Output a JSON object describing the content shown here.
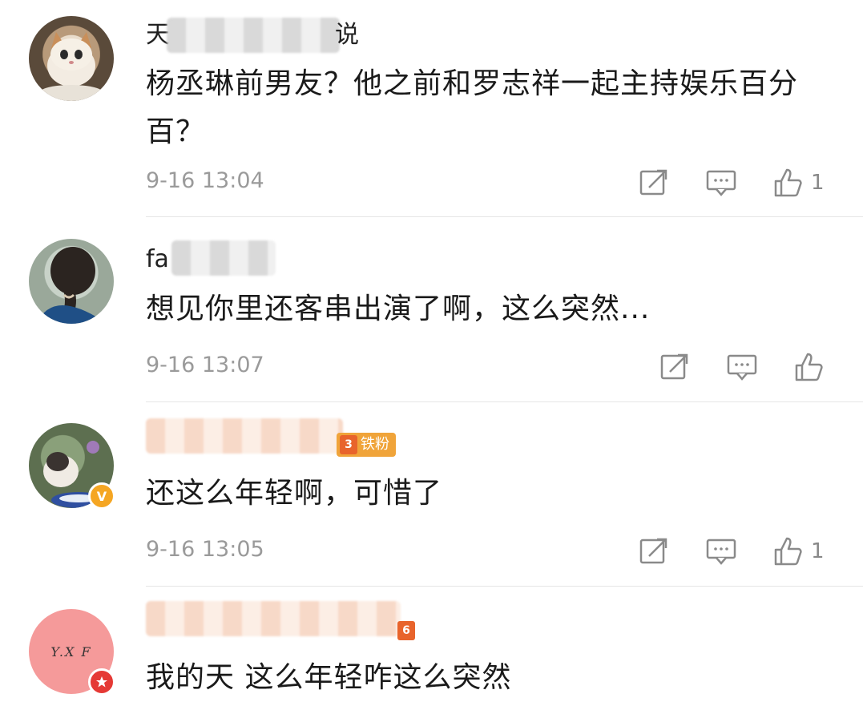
{
  "comments": [
    {
      "username": "天",
      "username_end": "说",
      "text": "杨丞琳前男友？他之前和罗志祥一起主持娱乐百分百？",
      "time": "9-16 13:04",
      "likes": "1",
      "avatar_desc": "cat-avatar"
    },
    {
      "username": "fa",
      "username_end": "",
      "text": "想见你里还客串出演了啊，这么突然...",
      "time": "9-16 13:07",
      "likes": "",
      "avatar_desc": "person-back-avatar"
    },
    {
      "username": "",
      "fan_badge": "铁粉",
      "fan_level": "3",
      "text": "还这么年轻啊，可惜了",
      "time": "9-16 13:05",
      "likes": "1",
      "avatar_desc": "cat-plant-avatar",
      "verified_badge": "V"
    },
    {
      "username": "",
      "fan_level": "6",
      "text": "我的天 这么年轻咋这么突然",
      "avatar_text": "Y.X F",
      "avatar_desc": "initials-avatar"
    }
  ],
  "colors": {
    "text": "#1a1a1a",
    "time": "#9a9a9a",
    "icon": "#8a8a8a",
    "fan_badge": "#f0a43a",
    "verified": "#f5a623",
    "star_badge": "#e53935",
    "yxf_avatar": "#f59a9a"
  }
}
